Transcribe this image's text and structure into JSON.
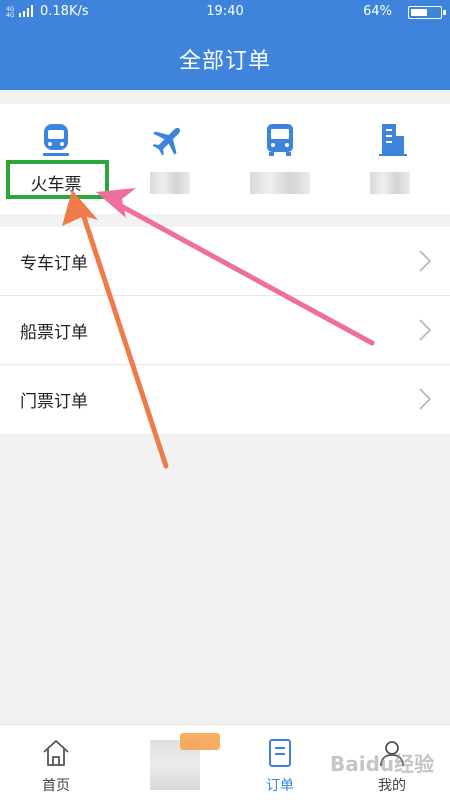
{
  "status": {
    "signal": "4G 4G",
    "speed": "0.18K/s",
    "time": "19:40",
    "battery": "64%",
    "battery_level": 0.64
  },
  "header": {
    "title": "全部订单"
  },
  "categories": [
    {
      "label": "火车票",
      "icon": "train-icon",
      "blurred": false
    },
    {
      "label": "",
      "icon": "airplane-icon",
      "blurred": true
    },
    {
      "label": "",
      "icon": "bus-icon",
      "blurred": true
    },
    {
      "label": "",
      "icon": "hotel-building-icon",
      "blurred": true
    }
  ],
  "orders": [
    {
      "label": "专车订单"
    },
    {
      "label": "船票订单"
    },
    {
      "label": "门票订单"
    }
  ],
  "tabbar": {
    "items": [
      {
        "label": "首页",
        "icon": "home-icon"
      },
      {
        "label": "",
        "icon": "blurred-icon"
      },
      {
        "label": "订单",
        "icon": "order-document-icon",
        "active": true
      },
      {
        "label": "我的",
        "icon": "user-icon"
      }
    ]
  },
  "watermark": "Baidu经验",
  "colors": {
    "primary": "#3e84dc",
    "highlight_box": "#2aa83a",
    "arrow_orange": "#f07a4a",
    "arrow_pink": "#ee6f9e"
  }
}
